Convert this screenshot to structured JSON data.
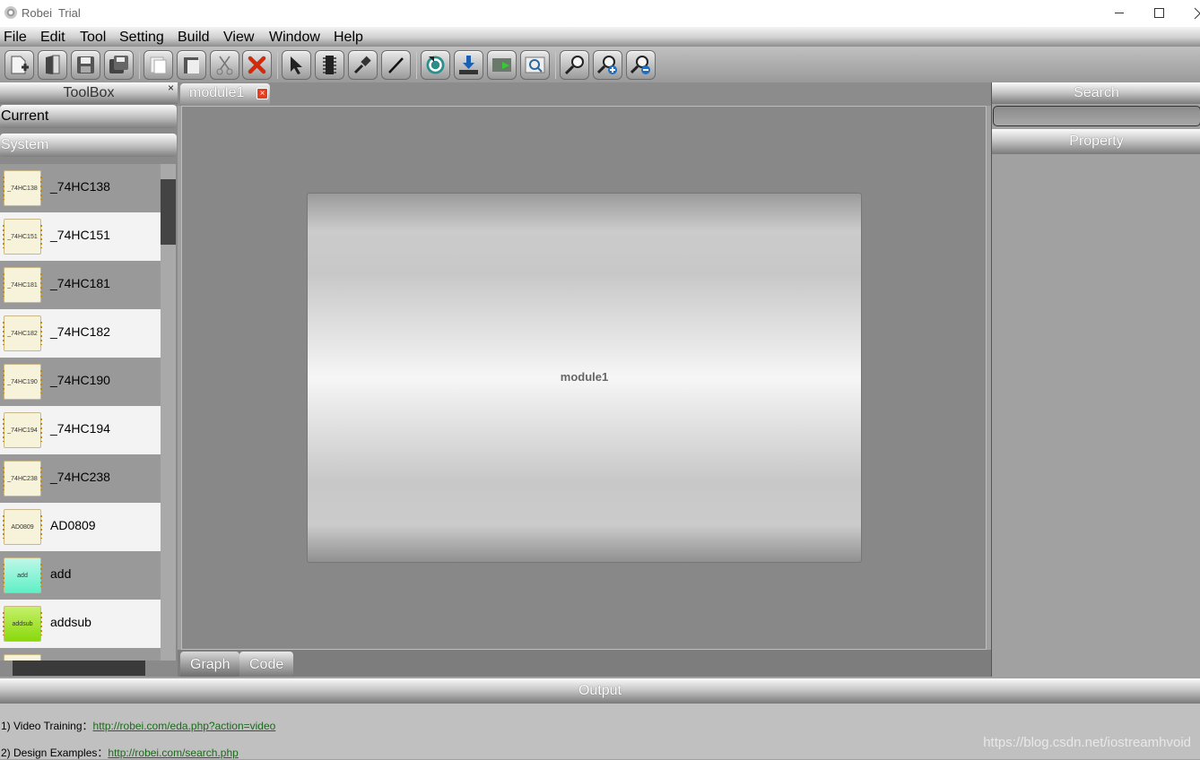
{
  "window": {
    "title": "Robei  Trial",
    "icon": "robei-gear-icon"
  },
  "menu": [
    "File",
    "Edit",
    "Tool",
    "Setting",
    "Build",
    "View",
    "Window",
    "Help"
  ],
  "toolbar": [
    {
      "name": "new-file-button",
      "icon": "new-file-icon"
    },
    {
      "name": "open-file-button",
      "icon": "open-book-icon"
    },
    {
      "name": "save-button",
      "icon": "floppy-disk-icon"
    },
    {
      "name": "save-all-button",
      "icon": "save-all-icon"
    },
    {
      "name": "copy-button",
      "icon": "copy-icon"
    },
    {
      "name": "paste-button",
      "icon": "paste-icon"
    },
    {
      "name": "cut-button",
      "icon": "scissors-icon"
    },
    {
      "name": "delete-button",
      "icon": "red-x-icon"
    },
    {
      "name": "select-tool-button",
      "icon": "pointer-arrow-icon"
    },
    {
      "name": "pin-tool-button",
      "icon": "chip-pins-icon"
    },
    {
      "name": "probe-tool-button",
      "icon": "probe-icon"
    },
    {
      "name": "wire-tool-button",
      "icon": "wire-line-icon"
    },
    {
      "name": "compile-button",
      "icon": "refresh-circle-icon"
    },
    {
      "name": "download-button",
      "icon": "download-tray-icon"
    },
    {
      "name": "simulate-button",
      "icon": "play-screen-icon"
    },
    {
      "name": "waveform-button",
      "icon": "monitor-magnify-icon"
    },
    {
      "name": "zoom-fit-button",
      "icon": "magnifier-icon"
    },
    {
      "name": "zoom-in-button",
      "icon": "zoom-in-icon"
    },
    {
      "name": "zoom-out-button",
      "icon": "zoom-out-icon"
    }
  ],
  "toolbox": {
    "title": "ToolBox",
    "close": "×",
    "categories": [
      "Current",
      "System"
    ],
    "items": [
      {
        "name": "_74HC138",
        "chip": "_74HC138",
        "style": "cream"
      },
      {
        "name": "_74HC151",
        "chip": "_74HC151",
        "style": "cream"
      },
      {
        "name": "_74HC181",
        "chip": "_74HC181",
        "style": "cream"
      },
      {
        "name": "_74HC182",
        "chip": "_74HC182",
        "style": "cream"
      },
      {
        "name": "_74HC190",
        "chip": "_74HC190",
        "style": "cream"
      },
      {
        "name": "_74HC194",
        "chip": "_74HC194",
        "style": "cream"
      },
      {
        "name": "_74HC238",
        "chip": "_74HC238",
        "style": "cream"
      },
      {
        "name": "AD0809",
        "chip": "AD0809",
        "style": "cream"
      },
      {
        "name": "add",
        "chip": "add",
        "style": "cyan"
      },
      {
        "name": "addsub",
        "chip": "addsub",
        "style": "lime"
      }
    ]
  },
  "editor": {
    "tab": "module1",
    "tab_close": "×",
    "module_label": "module1",
    "view_tabs": [
      "Graph",
      "Code"
    ]
  },
  "right": {
    "search": "Search",
    "search_value": "",
    "property": "Property"
  },
  "output": {
    "title": "Output",
    "lines": [
      {
        "label": "1) Video Training：",
        "link": "http://robei.com/eda.php?action=video"
      },
      {
        "label": "2) Design Examples：",
        "link": "http://robei.com/search.php"
      }
    ],
    "watermark": "https://blog.csdn.net/iostreamhvoid"
  },
  "colors": {
    "chip_pin": "#c38a10",
    "delete_red": "#d42a0c",
    "link": "#0000ee",
    "tab_close": "#e43d20"
  }
}
